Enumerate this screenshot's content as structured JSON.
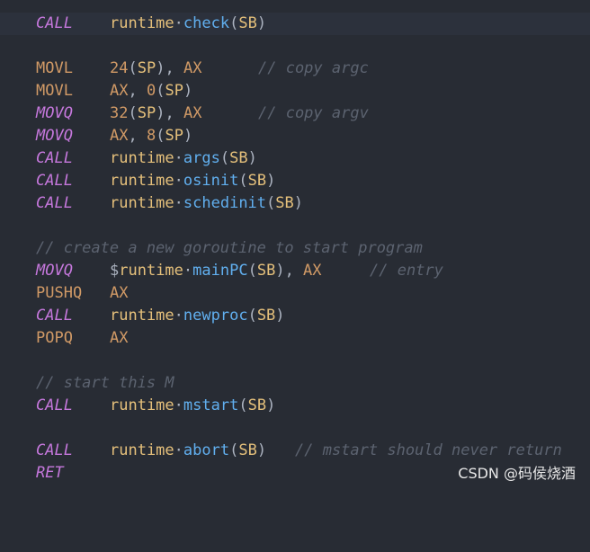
{
  "code": {
    "lines": [
      {
        "op": "CALL",
        "ns": "runtime",
        "sep": "·",
        "fn": "check",
        "arg": "SB",
        "comment": ""
      },
      {
        "blank": true
      },
      {
        "op": "MOVL",
        "args_text": "24(SP), AX",
        "comment": "// copy argc"
      },
      {
        "op": "MOVL",
        "args_text": "AX, 0(SP)",
        "comment": ""
      },
      {
        "op": "MOVQ",
        "args_text": "32(SP), AX",
        "comment": "// copy argv"
      },
      {
        "op": "MOVQ",
        "args_text": "AX, 8(SP)",
        "comment": ""
      },
      {
        "op": "CALL",
        "ns": "runtime",
        "sep": "·",
        "fn": "args",
        "arg": "SB",
        "comment": ""
      },
      {
        "op": "CALL",
        "ns": "runtime",
        "sep": "·",
        "fn": "osinit",
        "arg": "SB",
        "comment": ""
      },
      {
        "op": "CALL",
        "ns": "runtime",
        "sep": "·",
        "fn": "schedinit",
        "arg": "SB",
        "comment": ""
      },
      {
        "blank": true
      },
      {
        "full_comment": "// create a new goroutine to start program"
      },
      {
        "op": "MOVQ",
        "args_text": "$runtime·mainPC(SB), AX",
        "comment": "// entry"
      },
      {
        "op": "PUSHQ",
        "args_text": "AX",
        "comment": ""
      },
      {
        "op": "CALL",
        "ns": "runtime",
        "sep": "·",
        "fn": "newproc",
        "arg": "SB",
        "comment": ""
      },
      {
        "op": "POPQ",
        "args_text": "AX",
        "comment": ""
      },
      {
        "blank": true
      },
      {
        "full_comment": "// start this M"
      },
      {
        "op": "CALL",
        "ns": "runtime",
        "sep": "·",
        "fn": "mstart",
        "arg": "SB",
        "comment": ""
      },
      {
        "blank": true
      },
      {
        "op": "CALL",
        "ns": "runtime",
        "sep": "·",
        "fn": "abort",
        "arg": "SB",
        "comment": "// mstart should never return"
      },
      {
        "op": "RET",
        "args_text": "",
        "comment": ""
      }
    ]
  },
  "watermark": "CSDN @码侯烧酒"
}
